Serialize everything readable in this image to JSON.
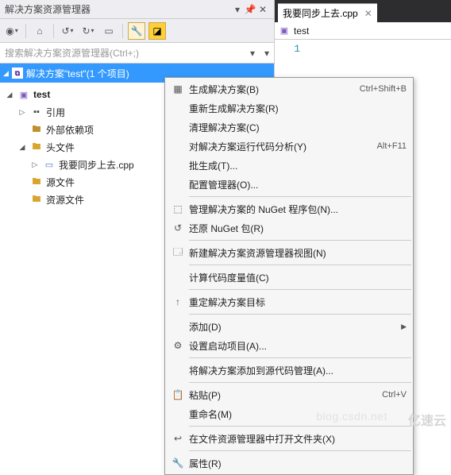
{
  "panel": {
    "title": "解决方案资源管理器",
    "search_placeholder": "搜索解决方案资源管理器(Ctrl+;)",
    "solution_label": "解决方案\"test\"(1 个项目)"
  },
  "tree": {
    "project": "test",
    "ref": "引用",
    "ext": "外部依赖项",
    "headers": "头文件",
    "header_file": "我要同步上去.cpp",
    "sources": "源文件",
    "resources": "资源文件"
  },
  "editor": {
    "tab_label": "我要同步上去.cpp",
    "crumb": "test",
    "line1": "1"
  },
  "menu": {
    "build": "生成解决方案(B)",
    "build_sc": "Ctrl+Shift+B",
    "rebuild": "重新生成解决方案(R)",
    "clean": "清理解决方案(C)",
    "analyze": "对解决方案运行代码分析(Y)",
    "analyze_sc": "Alt+F11",
    "batch": "批生成(T)...",
    "config": "配置管理器(O)...",
    "nuget_mgr": "管理解决方案的 NuGet 程序包(N)...",
    "nuget_restore": "还原 NuGet 包(R)",
    "newview": "新建解决方案资源管理器视图(N)",
    "metrics": "计算代码度量值(C)",
    "retarget": "重定解决方案目标",
    "add": "添加(D)",
    "startup": "设置启动项目(A)...",
    "addscc": "将解决方案添加到源代码管理(A)...",
    "paste": "粘贴(P)",
    "paste_sc": "Ctrl+V",
    "rename": "重命名(M)",
    "open_folder": "在文件资源管理器中打开文件夹(X)",
    "props": "属性(R)"
  },
  "watermark": {
    "url": "blog.csdn.net",
    "logo": "亿速云"
  }
}
